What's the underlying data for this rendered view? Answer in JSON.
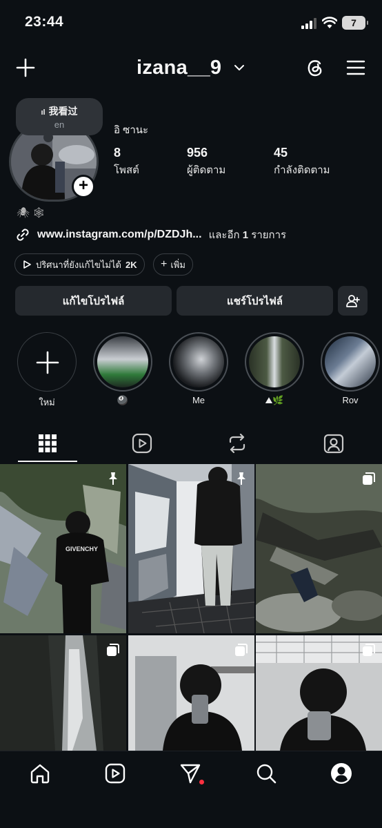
{
  "status_bar": {
    "time": "23:44",
    "battery": "7",
    "icons": [
      "signal-icon",
      "wifi-icon",
      "battery-icon"
    ]
  },
  "top_bar": {
    "username": "izana__9",
    "icons": [
      "plus-icon",
      "chevron-down-icon",
      "threads-icon",
      "menu-icon"
    ]
  },
  "note": {
    "title": "我看过",
    "subtitle": "en"
  },
  "profile": {
    "display_name": "อิ ซานะ",
    "stats": [
      {
        "value": "8",
        "label": "โพสต์"
      },
      {
        "value": "956",
        "label": "ผู้ติดตาม"
      },
      {
        "value": "45",
        "label": "กำลังติดตาม"
      }
    ],
    "bio_emojis": "🕷🕸",
    "link": "www.instagram.com/p/DZDJh...",
    "link_more_prefix": "และอีก",
    "link_more_count": "1",
    "link_more_suffix": "รายการ"
  },
  "chips": {
    "puzzle_label": "ปริศนาที่ยังแก้ไขไม่ได้",
    "puzzle_count": "2K",
    "add_label": "เพิ่ม"
  },
  "buttons": {
    "edit_profile": "แก้ไขโปรไฟล์",
    "share_profile": "แชร์โปรไฟล์"
  },
  "highlights": {
    "new_label": "ใหม่",
    "items": [
      {
        "label": "🎱"
      },
      {
        "label": "Me"
      },
      {
        "label": "⛰🌿"
      },
      {
        "label": "Rov"
      }
    ]
  },
  "tabs": [
    "grid-icon",
    "reels-icon",
    "reposts-icon",
    "tagged-icon"
  ],
  "posts": [
    {
      "badge": "pin-icon"
    },
    {
      "badge": "pin-icon"
    },
    {
      "badge": "carousel-icon"
    },
    {
      "badge": "carousel-icon"
    },
    {
      "badge": "carousel-icon"
    },
    {
      "badge": "carousel-icon"
    }
  ],
  "post_text": {
    "hoodie_brand": "GIVENCHY"
  },
  "bottom_nav": [
    "home-icon",
    "reels-icon",
    "direct-icon",
    "search-icon",
    "profile-icon"
  ],
  "colors": {
    "background": "#0c1014",
    "button": "#25292e",
    "notification_dot": "#ff3040"
  }
}
